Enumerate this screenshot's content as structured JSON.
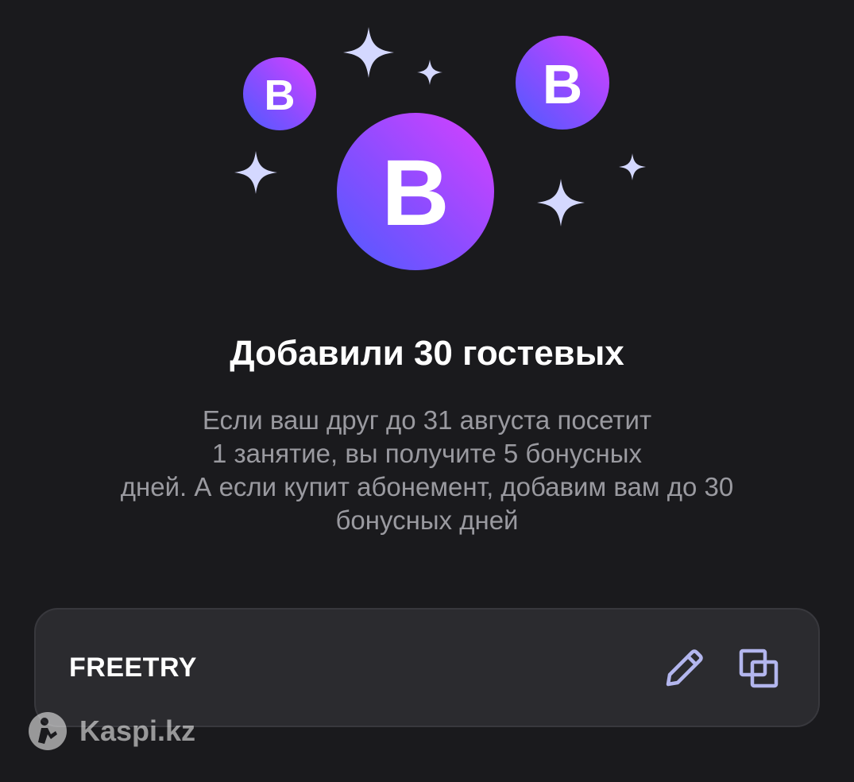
{
  "illustration": {
    "coin_letter": "B",
    "colors": {
      "gradient_start": "#4f5bff",
      "gradient_end": "#d940ff",
      "sparkle": "#d4d8ff"
    }
  },
  "title": "Добавили 30 гостевых",
  "description": "Если ваш друг до 31 августа посетит 1 занятие, вы получите 5 бонусных дней. А если купит абонемент, добавим вам до 30 бонусных дней",
  "description_lines": [
    "Если ваш друг до 31 августа посетит",
    "1 занятие, вы получите 5 бонусных",
    "дней. А если купит абонемент, добавим вам до 30",
    "бонусных дней"
  ],
  "promo": {
    "code": "FREETRY",
    "edit_icon": "pencil-icon",
    "copy_icon": "copy-icon"
  },
  "watermark": {
    "text": "Kaspi.kz"
  },
  "colors": {
    "background": "#1a1a1d",
    "card": "#2b2b2f",
    "icon": "#b3b6ee",
    "text_primary": "#ffffff",
    "text_secondary": "#9a9aa0"
  }
}
